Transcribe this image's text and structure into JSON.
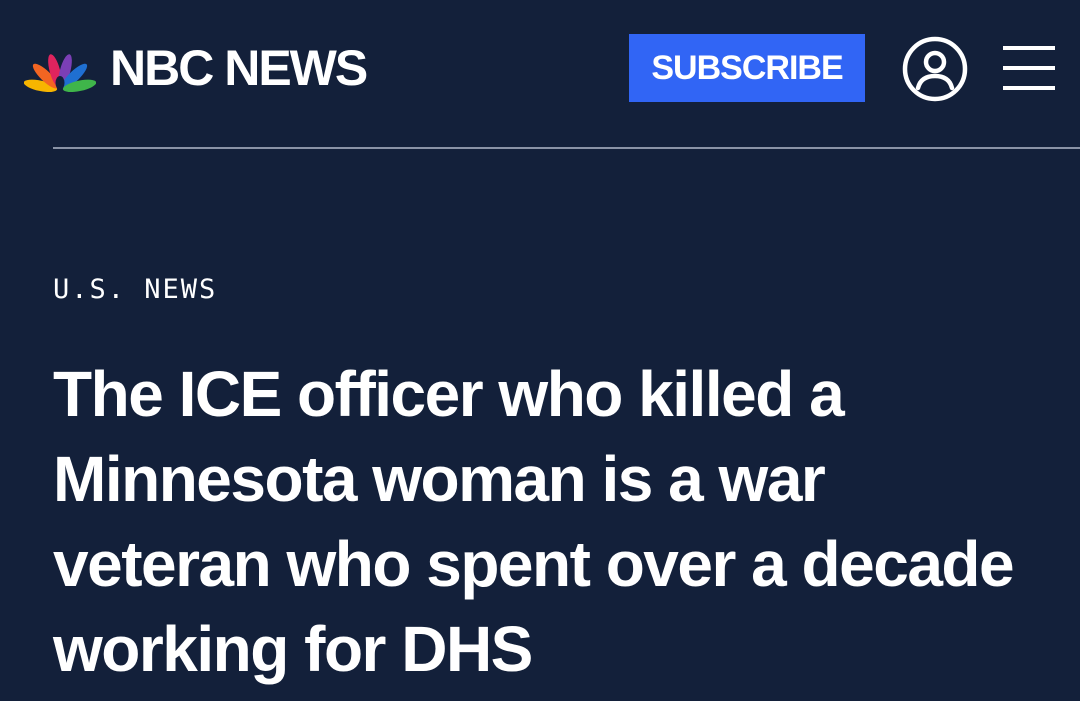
{
  "header": {
    "logo_text": "NBC NEWS",
    "subscribe_label": "SUBSCRIBE",
    "account_icon": "account-circle-icon",
    "menu_icon": "hamburger-menu-icon"
  },
  "article": {
    "section": "U.S. NEWS",
    "headline_lines": [
      "The ICE officer who killed a",
      "Minnesota woman is a war",
      "veteran who spent over a decade",
      "working for DHS"
    ]
  },
  "colors": {
    "background": "#13203a",
    "subscribe_button": "#3165f5",
    "text": "#ffffff",
    "divider": "#8a93a6",
    "peacock": [
      "#f7b500",
      "#f26522",
      "#e0245e",
      "#7b3fb6",
      "#1f6fd1",
      "#3fb54a"
    ]
  }
}
